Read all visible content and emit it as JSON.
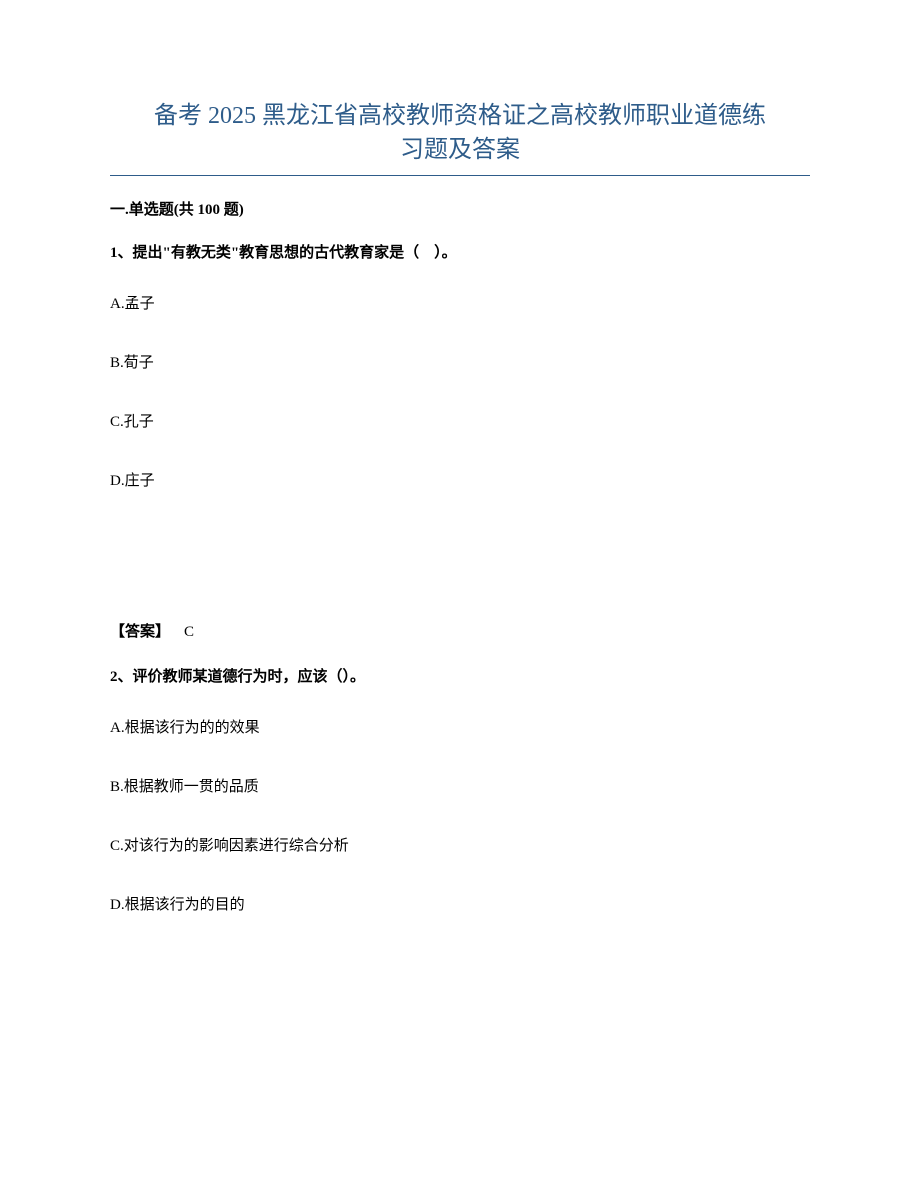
{
  "title": {
    "line1": "备考 2025 黑龙江省高校教师资格证之高校教师职业道德练",
    "line2": "习题及答案"
  },
  "section_header": "一.单选题(共 100 题)",
  "questions": [
    {
      "number": "1、",
      "text": "提出\"有教无类\"教育思想的古代教育家是（　）。",
      "options": {
        "A": "A.孟子",
        "B": "B.荀子",
        "C": "C.孔子",
        "D": "D.庄子"
      },
      "answer_label": "【答案】",
      "answer_value": "C"
    },
    {
      "number": "2、",
      "text": "评价教师某道德行为时，应该（）。",
      "options": {
        "A": "A.根据该行为的的效果",
        "B": "B.根据教师一贯的品质",
        "C": "C.对该行为的影响因素进行综合分析",
        "D": "D.根据该行为的目的"
      }
    }
  ]
}
